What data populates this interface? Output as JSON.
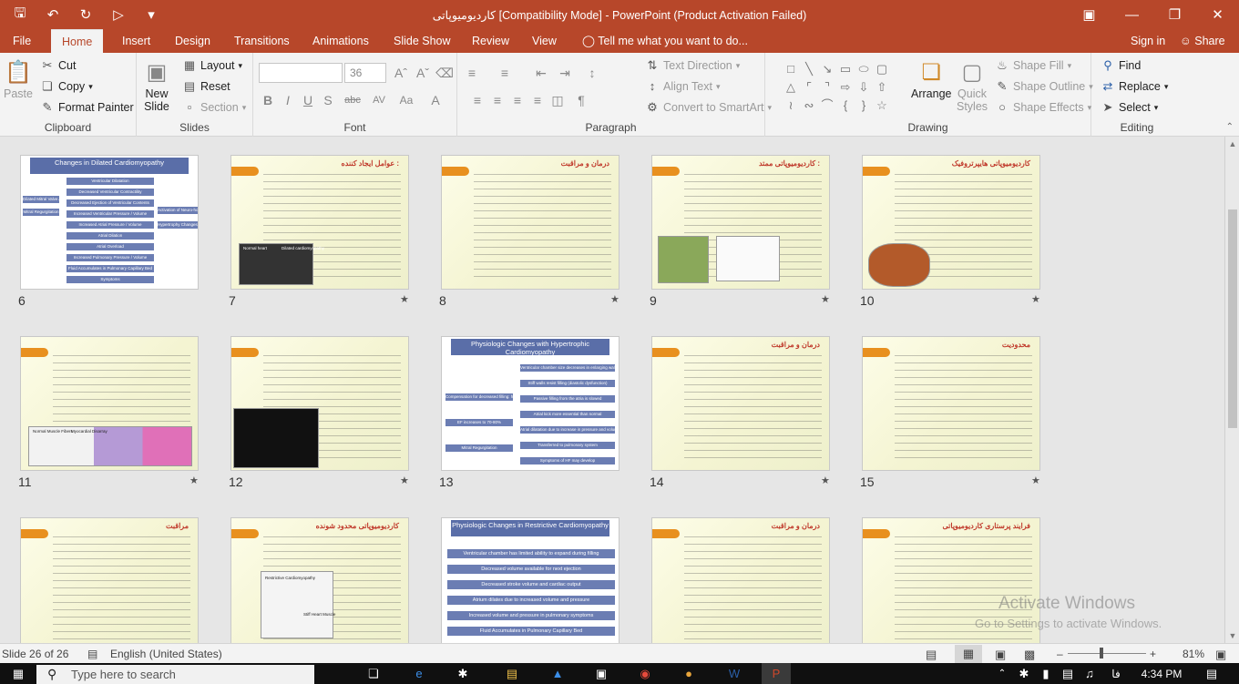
{
  "window": {
    "title": "کاردیومیوپاتی [Compatibility Mode] - PowerPoint (Product Activation Failed)",
    "quick_access": [
      "save-icon",
      "undo-icon",
      "redo-icon",
      "present-icon",
      "customize-icon"
    ]
  },
  "tabs": [
    "File",
    "Home",
    "Insert",
    "Design",
    "Transitions",
    "Animations",
    "Slide Show",
    "Review",
    "View"
  ],
  "active_tab": "Home",
  "tell_me": "Tell me what you want to do...",
  "sign_in": "Sign in",
  "share": "Share",
  "ribbon": {
    "clipboard": {
      "label": "Clipboard",
      "paste": "Paste",
      "cut": "Cut",
      "copy": "Copy",
      "format_painter": "Format Painter"
    },
    "slides": {
      "label": "Slides",
      "new_slide_1": "New",
      "new_slide_2": "Slide",
      "layout": "Layout",
      "reset": "Reset",
      "section": "Section"
    },
    "font": {
      "label": "Font",
      "font_name": "",
      "font_size": "36",
      "bold": "B",
      "italic": "I",
      "underline": "U",
      "strike": "S",
      "shadow": "abc",
      "spacing": "AV",
      "case": "Aa",
      "color": "A"
    },
    "paragraph": {
      "label": "Paragraph",
      "text_direction": "Text Direction",
      "align_text": "Align Text",
      "smartart": "Convert to SmartArt"
    },
    "drawing": {
      "label": "Drawing",
      "arrange": "Arrange",
      "quick_styles_1": "Quick",
      "quick_styles_2": "Styles",
      "shape_fill": "Shape Fill",
      "shape_outline": "Shape Outline",
      "shape_effects": "Shape Effects"
    },
    "editing": {
      "label": "Editing",
      "find": "Find",
      "replace": "Replace",
      "select": "Select"
    }
  },
  "slides": [
    {
      "num": "6",
      "type": "flow",
      "title": "Changes in Dilated Cardiomyopathy",
      "star": false,
      "boxes": [
        "Ventricular Dilatation",
        "Decreased Ventricular Contractility",
        "Decreased Ejection of Ventricular Contents",
        "Increased Ventricular Pressure / Volume",
        "Increased Atrial Pressure / Volume",
        "Atrial Dilation",
        "Atrial Overload",
        "Increased Pulmonary Pressure / Volume",
        "Fluid Accumulates in Pulmonary Capillary Bed",
        "Symptoms",
        "Dilated Mitral Valve Annulus",
        "Mitral Regurgitation",
        "Activation of Neuro-hormonal Responses",
        "Hypertrophy Changes / Fluid Retention"
      ]
    },
    {
      "num": "7",
      "type": "text",
      "title": "عوامل ایجاد کننده :",
      "star": true,
      "img_labels": [
        "Normal heart",
        "Dilated cardiomyopathy"
      ]
    },
    {
      "num": "8",
      "type": "text",
      "title": "درمان و مراقبت",
      "star": true
    },
    {
      "num": "9",
      "type": "text",
      "title": "کاردیومیوپاتی ممتد :",
      "star": true
    },
    {
      "num": "10",
      "type": "text",
      "title": "کاردیومیوپاتی هایپرتروفیک",
      "star": true
    },
    {
      "num": "11",
      "type": "text",
      "title": "",
      "star": true,
      "img_labels": [
        "Normal Muscle Fibers",
        "Myocardial Disarray"
      ]
    },
    {
      "num": "12",
      "type": "text",
      "title": "",
      "star": true
    },
    {
      "num": "13",
      "type": "flow2",
      "title": "Physiologic Changes with Hypertrophic Cardiomyopathy",
      "star": false,
      "boxes": [
        "Ventricular chamber size decreases in enlarging walls close to no chamber",
        "Stiff walls resist filling (diastolic dysfunction)",
        "Passive filling from the atria is slowed",
        "Atrial kick more essential than normal",
        "Atrial dilatation due to increase in pressure and volume",
        "Transferred to pulmonary system",
        "Symptoms of HF may develop",
        "Compensation for decreased filling: hyperdynamic systolic dysfunction",
        "EF increases to 70-80%",
        "Mitral Regurgitation"
      ]
    },
    {
      "num": "14",
      "type": "text",
      "title": "درمان و مراقبت",
      "star": true
    },
    {
      "num": "15",
      "type": "text",
      "title": "محدودیت",
      "star": true
    },
    {
      "num": "16",
      "type": "text",
      "title": "مراقبت",
      "star": false
    },
    {
      "num": "17",
      "type": "text",
      "title": "کاردیومیوپاتی محدود شونده",
      "star": false,
      "img_labels": [
        "Restrictive Cardiomyopathy",
        "Stiff Heart Muscle"
      ]
    },
    {
      "num": "18",
      "type": "flow3",
      "title": "Physiologic Changes in Restrictive Cardiomyopathy",
      "star": false,
      "boxes": [
        "Ventricular chamber has limited ability to expand during filling",
        "Decreased volume available for next ejection",
        "Decreased stroke volume and cardiac output",
        "Atrium dilates due to increased volume and pressure",
        "Increased volume and pressure in pulmonary symptoms",
        "Fluid Accumulates in Pulmonary Capillary Bed"
      ]
    },
    {
      "num": "19",
      "type": "text",
      "title": "درمان و مراقبت",
      "star": false
    },
    {
      "num": "20",
      "type": "text",
      "title": "فرایند پرستاری کاردیومیوپاتی",
      "star": false
    }
  ],
  "status": {
    "slide_info": "Slide 26 of 26",
    "language": "English (United States)",
    "zoom": "81%",
    "zoom_fraction": 0.81
  },
  "watermark": {
    "line1": "Activate Windows",
    "line2": "Go to Settings to activate Windows."
  },
  "taskbar": {
    "search_placeholder": "Type here to search",
    "time": "4:34 PM",
    "lang": "فا"
  },
  "colors": {
    "accent": "#b7472a",
    "slide_orange": "#e8901f",
    "flow_blue": "#6b7db3"
  }
}
